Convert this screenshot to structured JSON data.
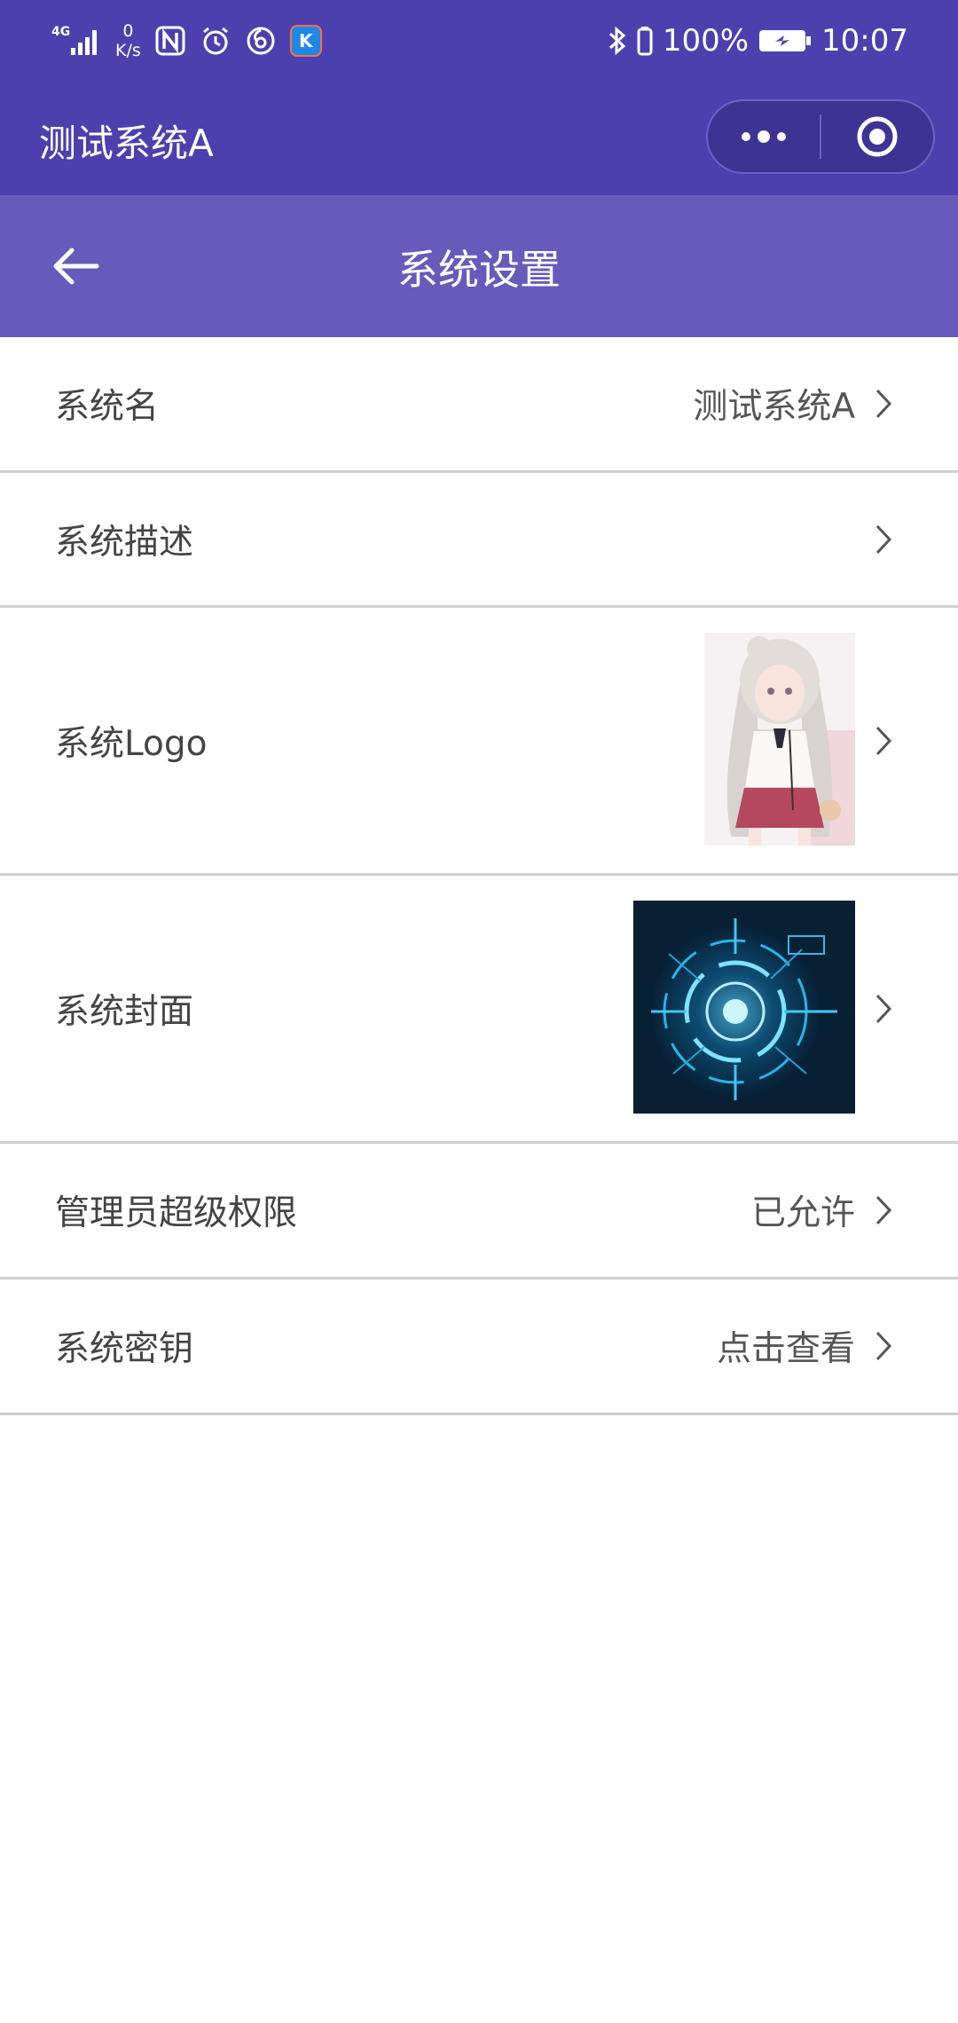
{
  "status_bar": {
    "network": "4G",
    "speed_value": "0",
    "speed_unit": "K/s",
    "battery": "100%",
    "time": "10:07"
  },
  "mini_program": {
    "title": "测试系统A",
    "more_icon": "more-dots-icon",
    "close_icon": "target-circle-icon"
  },
  "header": {
    "title": "系统设置",
    "back_icon": "arrow-left-icon"
  },
  "settings": [
    {
      "label": "系统名",
      "value": "测试系统A"
    },
    {
      "label": "系统描述",
      "value": ""
    },
    {
      "label": "系统Logo",
      "image": "anime-girl-portrait"
    },
    {
      "label": "系统封面",
      "image": "blue-tech-circle"
    },
    {
      "label": "管理员超级权限",
      "value": "已允许"
    },
    {
      "label": "系统密钥",
      "value": "点击查看"
    }
  ],
  "colors": {
    "navbar": "#4b40ad",
    "header": "#665bbb",
    "divider": "#cfcfcf",
    "text": "#444444"
  }
}
